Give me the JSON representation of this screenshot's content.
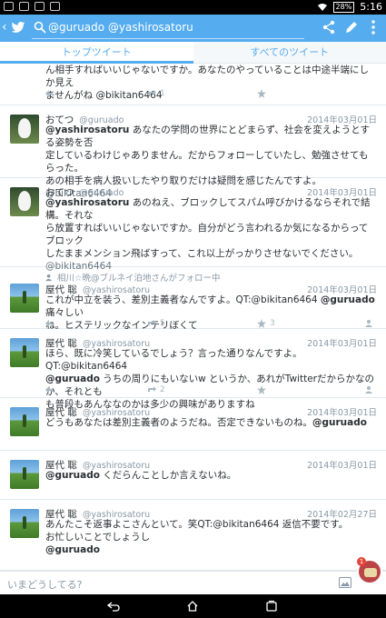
{
  "status_bar": {
    "battery": "28%",
    "time": "5:16"
  },
  "action_bar": {
    "query": "@guruado @yashirosatoru",
    "icons": [
      "back-icon",
      "twitter-bird-icon",
      "search-icon",
      "share-icon",
      "compose-icon",
      "overflow-menu-icon"
    ]
  },
  "tabs": [
    {
      "label": "トップツイート"
    },
    {
      "label": "すべてのツイート"
    }
  ],
  "tweets": [
    {
      "body_lines": [
        "ん相手すればいいじゃないですか。あなたのやっていることは中途半端にしか見え",
        "ませんがね @bikitan6464"
      ],
      "retweets": "1"
    },
    {
      "name": "おてつ",
      "handle": "@guruado",
      "date": "2014年03月01日",
      "body_mention": "@yashirosatoru",
      "body_lines": [
        " あなたの学問の世界にとどまらず、社会を変えようとする姿勢を否",
        "定しているわけじゃありません。だからフォローしていたし、勉強させてもらった。",
        "あの相手を病人扱いしたやり取りだけは疑問を感じたんですよ。"
      ],
      "tail_mention": "@bikitan6464"
    },
    {
      "name": "おてつ",
      "handle": "@guruado",
      "date": "2014年03月01日",
      "body_mention": "@yashirosatoru",
      "body_lines": [
        " あのねえ、ブロックしてスパム呼びかけるならそれで結構。それな",
        "ら放置すればいいじゃないですか。自分がどう言われるか気になるからってブロック",
        "したままメンション飛ばすって、これ以上がっかりさせないでください。"
      ],
      "tail_mention": "@bikitan6464"
    },
    {
      "retweeted_by": "相川☆晩@ブルネイ泊地さんがフォロー中",
      "name": "屋代 聡",
      "handle": "@yashirosatoru",
      "date": "2014年03月01日",
      "body_lines": [
        "これが中立を装う、差別主義者なんですよ。QT:@bikitan6464 ",
        " 痛々しい",
        "ね。ヒステリックなインテリぼくて"
      ],
      "qt_mention": "@guruado",
      "retweets": "5",
      "favorites": "3"
    },
    {
      "name": "屋代 聡",
      "handle": "@yashirosatoru",
      "date": "2014年03月01日",
      "body_lines": [
        "ほら、既に冷笑しているでしょう？言った通りなんですよ。QT:@bikitan6464",
        " うちの周りにもいないw というか、あれがTwitterだからかなのか、それとも",
        "も普段もあんななのかは多少の興味がありますね"
      ],
      "qt_mention": "@guruado",
      "retweets": "2"
    },
    {
      "name": "屋代 聡",
      "handle": "@yashirosatoru",
      "date": "2014年03月01日",
      "body_text": "どうもあなたは差別主義者のようだね。否定できないものね。",
      "tail_mention": "@guruado"
    },
    {
      "name": "屋代 聡",
      "handle": "@yashirosatoru",
      "date": "2014年03月01日",
      "body_mention": "@guruado",
      "body_text": " くだらんことしか言えないね。"
    },
    {
      "name": "屋代 聡",
      "handle": "@yashirosatoru",
      "date": "2014年02月27日",
      "body_lines": [
        "あんたこそ返事よこさんといて。笑QT:@bikitan6464 返信不要です。",
        "お忙しいことでしょうし"
      ],
      "tail_mention": "@guruado"
    }
  ],
  "compose": {
    "placeholder": "いまどうしてる?",
    "badge": "1"
  },
  "colors": {
    "accent": "#55acee",
    "text": "#292f33",
    "muted": "#8899a6"
  }
}
